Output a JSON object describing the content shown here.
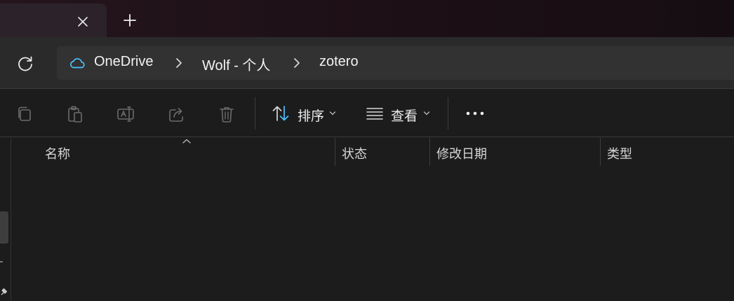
{
  "tabs": {
    "active_title": "",
    "close_icon": "close-icon",
    "new_tab_icon": "plus-icon"
  },
  "nav": {
    "refresh_icon": "refresh-icon",
    "breadcrumb": [
      {
        "label": "OneDrive",
        "icon": "cloud-icon"
      },
      {
        "label": "Wolf - 个人"
      },
      {
        "label": "zotero"
      }
    ]
  },
  "toolbar": {
    "copy_icon": "copy-icon",
    "paste_icon": "paste-icon",
    "rename_icon": "rename-icon",
    "share_icon": "share-icon",
    "delete_icon": "delete-icon",
    "sort_label": "排序",
    "view_label": "查看",
    "more_icon": "more-icon"
  },
  "columns": {
    "name": "名称",
    "status": "状态",
    "modified": "修改日期",
    "type": "类型"
  },
  "colors": {
    "accent": "#4cc2ff",
    "background": "#1c1c1c"
  }
}
